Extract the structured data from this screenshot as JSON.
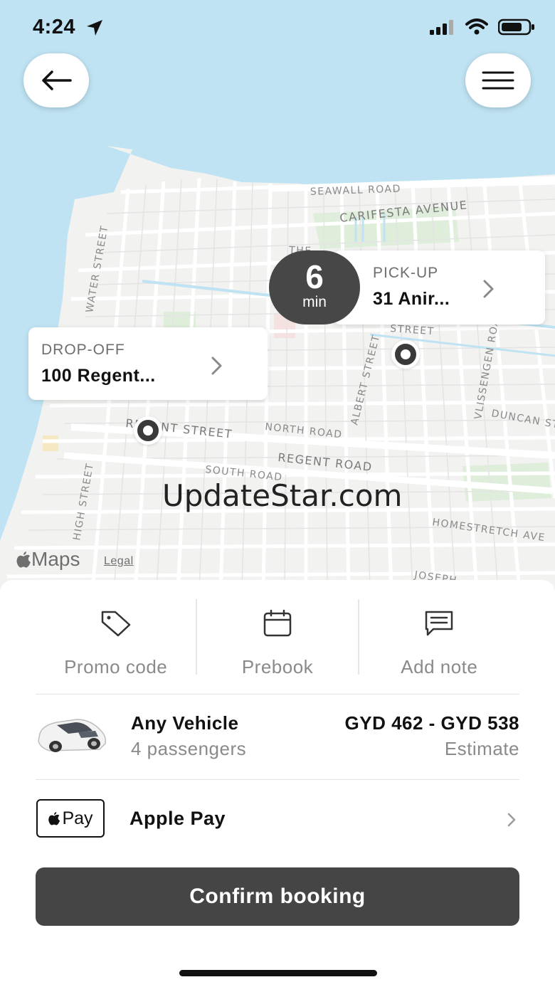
{
  "status_bar": {
    "time": "4:24"
  },
  "map": {
    "streets": [
      "SEAWALL ROAD",
      "CARIFESTA AVENUE",
      "WATER STREET",
      "NORTH ROAD",
      "REGENT ROAD",
      "SOUTH ROAD",
      "ALBERT STREET",
      "VLISSENGEN ROAD",
      "DUNCAN ST",
      "HOMESTRETCH AVE",
      "HIGH STREET",
      "JOSEPH",
      "REGENT STREET",
      "STREET",
      "THE"
    ],
    "pickup": {
      "eta_value": "6",
      "eta_unit": "min",
      "kicker": "PICK-UP",
      "address": "31 Anir..."
    },
    "dropoff": {
      "kicker": "DROP-OFF",
      "address": "100 Regent..."
    },
    "watermark": "UpdateStar.com",
    "attribution": {
      "brand": "Maps",
      "legal": "Legal"
    }
  },
  "options": [
    {
      "label": "Promo code",
      "icon": "tag-icon"
    },
    {
      "label": "Prebook",
      "icon": "calendar-icon"
    },
    {
      "label": "Add note",
      "icon": "note-icon"
    }
  ],
  "vehicle": {
    "name": "Any Vehicle",
    "capacity": "4 passengers",
    "price": "GYD 462 - GYD 538",
    "price_note": "Estimate"
  },
  "payment": {
    "badge": "Pay",
    "label": "Apple Pay"
  },
  "confirm_label": "Confirm booking",
  "colors": {
    "water": "#bfe3f3",
    "land": "#f2f2f0",
    "button_dark": "#454545"
  }
}
